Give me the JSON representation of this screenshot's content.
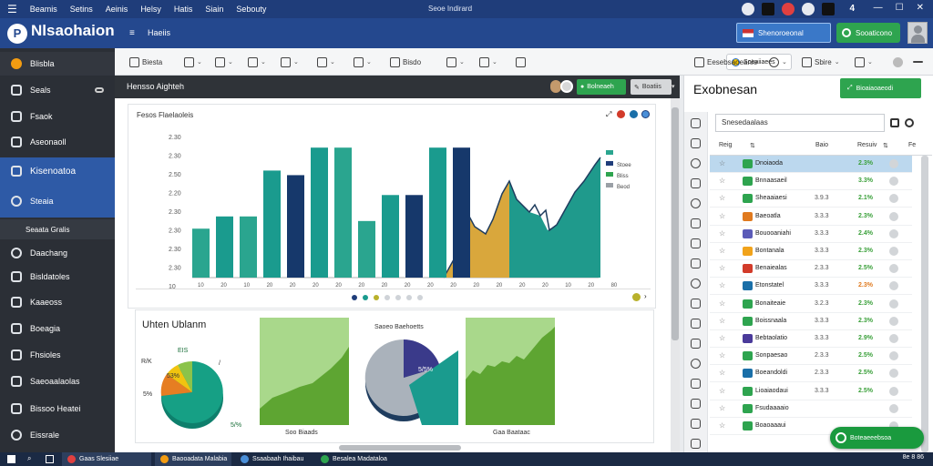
{
  "menubar": {
    "items": [
      "Beamis",
      "Setins",
      "Aeinis",
      "Helsy",
      "Hatis",
      "Siain",
      "Sebouty"
    ],
    "window_title": "Seoe Indirard",
    "count": "4"
  },
  "header": {
    "logo_letter": "P",
    "title": "Nlsaohaion",
    "sub_label": "Haeiis",
    "button_1": "Shenoroeonal",
    "button_2": "Sooaticono"
  },
  "sidebar": {
    "items": [
      {
        "label": "Blisbla",
        "icon": "brand-icon"
      },
      {
        "label": "Seals",
        "icon": "chart-icon"
      },
      {
        "label": "Fsaok",
        "icon": "user-icon"
      },
      {
        "label": "Aseonaoll",
        "icon": "mail-icon"
      },
      {
        "label": "Kisenoatoa",
        "icon": "grid-icon"
      },
      {
        "label": "Steaia",
        "icon": "shield-icon"
      },
      {
        "label": "Seaata Gralis",
        "icon": "none"
      },
      {
        "label": "Daachang",
        "icon": "cloud-icon"
      },
      {
        "label": "Bisldatoles",
        "icon": "line-icon"
      },
      {
        "label": "Kaaeoss",
        "icon": "list-icon"
      },
      {
        "label": "Boeagia",
        "icon": "screen-icon"
      },
      {
        "label": "Fhsioles",
        "icon": "table-icon"
      },
      {
        "label": "Saeoaalaolas",
        "icon": "calendar-icon"
      },
      {
        "label": "Bissoo Heatei",
        "icon": "server-icon"
      },
      {
        "label": "Eissrale",
        "icon": "clock-icon"
      }
    ]
  },
  "toolbar": {
    "items": [
      "Biesta",
      "",
      "",
      "",
      "",
      "",
      "",
      "Bisdo",
      "",
      "",
      ""
    ],
    "badge": "Soeaiiaees",
    "right_items": [
      "Eesebsaoeanie",
      "",
      "Sbire"
    ]
  },
  "main": {
    "header_title": "Hensso Aighteh",
    "green_button": "Bolneaeh",
    "grey_button": "Boatiis",
    "chart_card_title": "Fesos Flaelaoleis",
    "lower_card_title": "Uhten Ublanm",
    "pie_1_labels": [
      "EIS",
      "R/K",
      "5%",
      "53%",
      "5/%"
    ],
    "pie_2_title": "Saoeo Baehoetts",
    "pie_2_label": "5/5%",
    "area_1_caption": "Soo Biaads",
    "area_2_caption": "Gaa Baataac"
  },
  "chart_data": {
    "type": "bar",
    "title": "",
    "yticks": [
      "2.30",
      "2.30",
      "2.50",
      "2.20",
      "2.30",
      "2.30",
      "2.30",
      "2.30",
      "10"
    ],
    "xticks": [
      "10",
      "20",
      "10",
      "20",
      "20",
      "20",
      "20",
      "20",
      "20",
      "20",
      "20",
      "20",
      "20",
      "20",
      "20",
      "20",
      "10",
      "20",
      "80"
    ],
    "ylabel": "",
    "legend": [
      {
        "name": "",
        "color": "#2aa58f"
      },
      {
        "name": "Stoee",
        "color": "#1f3d7a"
      },
      {
        "name": "Bliss",
        "color": "#2ea44f"
      },
      {
        "name": "Beod",
        "color": "#9aa0a6"
      }
    ],
    "series": [
      {
        "name": "bars",
        "values": [
          0.32,
          0.4,
          0.4,
          0.7,
          0.67,
          0.85,
          0.85,
          0.37,
          0.54,
          0.54,
          0.85,
          0.85
        ]
      }
    ],
    "bar_colors": [
      "#2aa58f",
      "#1a9b8e",
      "#2aa58f",
      "#1a9b8e",
      "#16386b",
      "#1a9b8e",
      "#2aa58f",
      "#2aa58f",
      "#1a9b8e",
      "#16386b",
      "#1a9b8e",
      "#16386b"
    ]
  },
  "right_panel": {
    "title": "Exobnesan",
    "button": "Bioaiaoaeodi",
    "search_value": "Snesedaalaas",
    "col_headers": [
      "Reig",
      "Baio",
      "Resuiv"
    ],
    "rows": [
      {
        "name": "Dnoiaoda",
        "date": "",
        "pct": "2.3%",
        "pct_color": "#3aa03a",
        "icon": "#2ea44f",
        "sel": true
      },
      {
        "name": "Bnnaasaeil",
        "date": "",
        "pct": "3.3%",
        "pct_color": "#3aa03a",
        "icon": "#2ea44f",
        "sel": false
      },
      {
        "name": "Sheaaiaesi",
        "date": "3.9.3",
        "pct": "2.1%",
        "pct_color": "#3aa03a",
        "icon": "#2ea44f",
        "sel": false
      },
      {
        "name": "Baeoatla",
        "date": "3.3.3",
        "pct": "2.3%",
        "pct_color": "#3aa03a",
        "icon": "#e07a1f",
        "sel": false
      },
      {
        "name": "Bouooaniahi",
        "date": "3.3.3",
        "pct": "2.4%",
        "pct_color": "#3aa03a",
        "icon": "#5b5bb8",
        "sel": false
      },
      {
        "name": "Bontanala",
        "date": "3.3.3",
        "pct": "2.3%",
        "pct_color": "#3aa03a",
        "icon": "#f1a31b",
        "sel": false
      },
      {
        "name": "Benaiealas",
        "date": "2.3.3",
        "pct": "2.5%",
        "pct_color": "#3aa03a",
        "icon": "#d23b2a",
        "sel": false
      },
      {
        "name": "Etonstatel",
        "date": "3.3.3",
        "pct": "2.3%",
        "pct_color": "#e07a1f",
        "icon": "#1a6fa8",
        "sel": false
      },
      {
        "name": "Bonaiteaie",
        "date": "3.2.3",
        "pct": "2.3%",
        "pct_color": "#3aa03a",
        "icon": "#2ea44f",
        "sel": false
      },
      {
        "name": "Boissnaala",
        "date": "3.3.3",
        "pct": "2.3%",
        "pct_color": "#3aa03a",
        "icon": "#2ea44f",
        "sel": false
      },
      {
        "name": "Bebtaolatio",
        "date": "3.3.3",
        "pct": "2.9%",
        "pct_color": "#3aa03a",
        "icon": "#4a3a9a",
        "sel": false
      },
      {
        "name": "Sonpaesao",
        "date": "2.3.3",
        "pct": "2.5%",
        "pct_color": "#3aa03a",
        "icon": "#2ea44f",
        "sel": false
      },
      {
        "name": "Boeandoldi",
        "date": "2.3.3",
        "pct": "2.5%",
        "pct_color": "#3aa03a",
        "icon": "#1a6fa8",
        "sel": false
      },
      {
        "name": "Lioaiaodaui",
        "date": "3.3.3",
        "pct": "2.5%",
        "pct_color": "#3aa03a",
        "icon": "#2ea44f",
        "sel": false
      },
      {
        "name": "Fsudaaaaio",
        "date": "",
        "pct": "",
        "pct_color": "#3aa03a",
        "icon": "#2ea44f",
        "sel": false
      },
      {
        "name": "Boaoaaaui",
        "date": "",
        "pct": "",
        "pct_color": "#3aa03a",
        "icon": "#2ea44f",
        "sel": false
      }
    ],
    "float_button": "Boteaeeebsoa"
  },
  "taskbar": {
    "items": [
      "Gaas Slesiiae",
      "Baooadata Malabia",
      "Ssaabaah Ihaibau",
      "Besalea Madataloa"
    ],
    "tray": "8e 8 86"
  }
}
